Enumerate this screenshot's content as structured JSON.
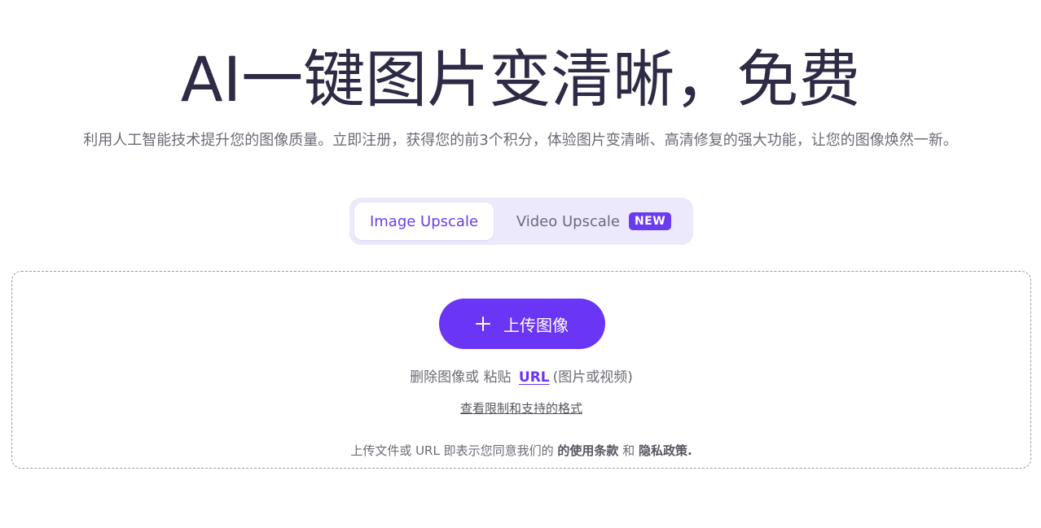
{
  "hero": {
    "title": "AI一键图片变清晰，免费",
    "subtitle": "利用人工智能技术提升您的图像质量。立即注册，获得您的前3个积分，体验图片变清晰、高清修复的强大功能，让您的图像焕然一新。"
  },
  "tabs": {
    "image_label": "Image Upscale",
    "video_label": "Video Upscale",
    "video_badge": "NEW",
    "active": "Image Upscale"
  },
  "upload": {
    "button_label": "上传图像",
    "paste_prefix": "删除图像或 粘贴",
    "url_label": "URL",
    "paste_suffix": "(图片或视频)",
    "limits_link": "查看限制和支持的格式",
    "terms_prefix": "上传文件或 URL 即表示您同意我们的",
    "terms_link": "的使用条款",
    "terms_and": "和",
    "privacy_link": "隐私政策."
  },
  "colors": {
    "accent": "#6a35f5",
    "title_text": "#2d2b45",
    "body_text": "#6b6b76",
    "tab_background": "#ece9fd"
  },
  "icons": {
    "upload_button_icon": "plus-icon"
  }
}
